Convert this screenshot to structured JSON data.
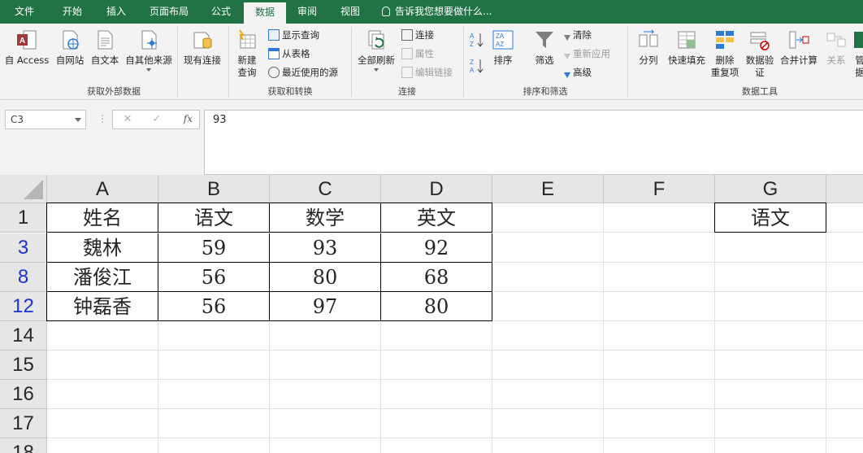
{
  "ribbon": {
    "tabs": [
      {
        "label": "文件",
        "active": false
      },
      {
        "label": "开始",
        "active": false
      },
      {
        "label": "插入",
        "active": false
      },
      {
        "label": "页面布局",
        "active": false
      },
      {
        "label": "公式",
        "active": false
      },
      {
        "label": "数据",
        "active": true
      },
      {
        "label": "审阅",
        "active": false
      },
      {
        "label": "视图",
        "active": false
      }
    ],
    "tell_me": "告诉我您想要做什么...",
    "groups": {
      "get_external": {
        "label": "获取外部数据",
        "from_access": "自 Access",
        "from_web": "自网站",
        "from_text": "自文本",
        "from_other": "自其他来源",
        "existing_conn": "现有连接"
      },
      "get_transform": {
        "label": "获取和转换",
        "new_query_1": "新建",
        "new_query_2": "查询",
        "show_queries": "显示查询",
        "from_table": "从表格",
        "recent_sources": "最近使用的源"
      },
      "connections": {
        "label": "连接",
        "refresh_all": "全部刷新",
        "connections": "连接",
        "properties": "属性",
        "edit_links": "编辑链接"
      },
      "sort_filter": {
        "label": "排序和筛选",
        "sort": "排序",
        "filter": "筛选",
        "clear": "清除",
        "reapply": "重新应用",
        "advanced": "高级"
      },
      "data_tools": {
        "label": "数据工具",
        "text_to_columns": "分列",
        "flash_fill": "快速填充",
        "remove_dup_1": "删除",
        "remove_dup_2": "重复项",
        "validation_1": "数据验",
        "validation_2": "证",
        "consolidate": "合并计算",
        "relationships": "关系",
        "manage_1": "管",
        "manage_2": "据"
      }
    }
  },
  "formula_bar": {
    "name_box": "C3",
    "content": "93"
  },
  "columns": [
    "A",
    "B",
    "C",
    "D",
    "E",
    "F",
    "G"
  ],
  "rows": [
    {
      "num": "1",
      "filtered": false,
      "cells": [
        "姓名",
        "语文",
        "数学",
        "英文",
        "",
        "",
        "语文"
      ]
    },
    {
      "num": "3",
      "filtered": true,
      "cells": [
        "魏林",
        "59",
        "93",
        "92",
        "",
        "",
        ""
      ]
    },
    {
      "num": "8",
      "filtered": true,
      "cells": [
        "潘俊江",
        "56",
        "80",
        "68",
        "",
        "",
        ""
      ]
    },
    {
      "num": "12",
      "filtered": true,
      "cells": [
        "钟磊香",
        "56",
        "97",
        "80",
        "",
        "",
        ""
      ]
    },
    {
      "num": "14",
      "filtered": false,
      "cells": [
        "",
        "",
        "",
        "",
        "",
        "",
        ""
      ]
    },
    {
      "num": "15",
      "filtered": false,
      "cells": [
        "",
        "",
        "",
        "",
        "",
        "",
        ""
      ]
    },
    {
      "num": "16",
      "filtered": false,
      "cells": [
        "",
        "",
        "",
        "",
        "",
        "",
        ""
      ]
    },
    {
      "num": "17",
      "filtered": false,
      "cells": [
        "",
        "",
        "",
        "",
        "",
        "",
        ""
      ]
    },
    {
      "num": "18",
      "filtered": false,
      "cells": [
        "",
        "",
        "",
        "",
        "",
        "",
        ""
      ]
    }
  ],
  "colors": {
    "ribbon_green": "#217346",
    "filtered_row_number": "#1a33cc"
  }
}
